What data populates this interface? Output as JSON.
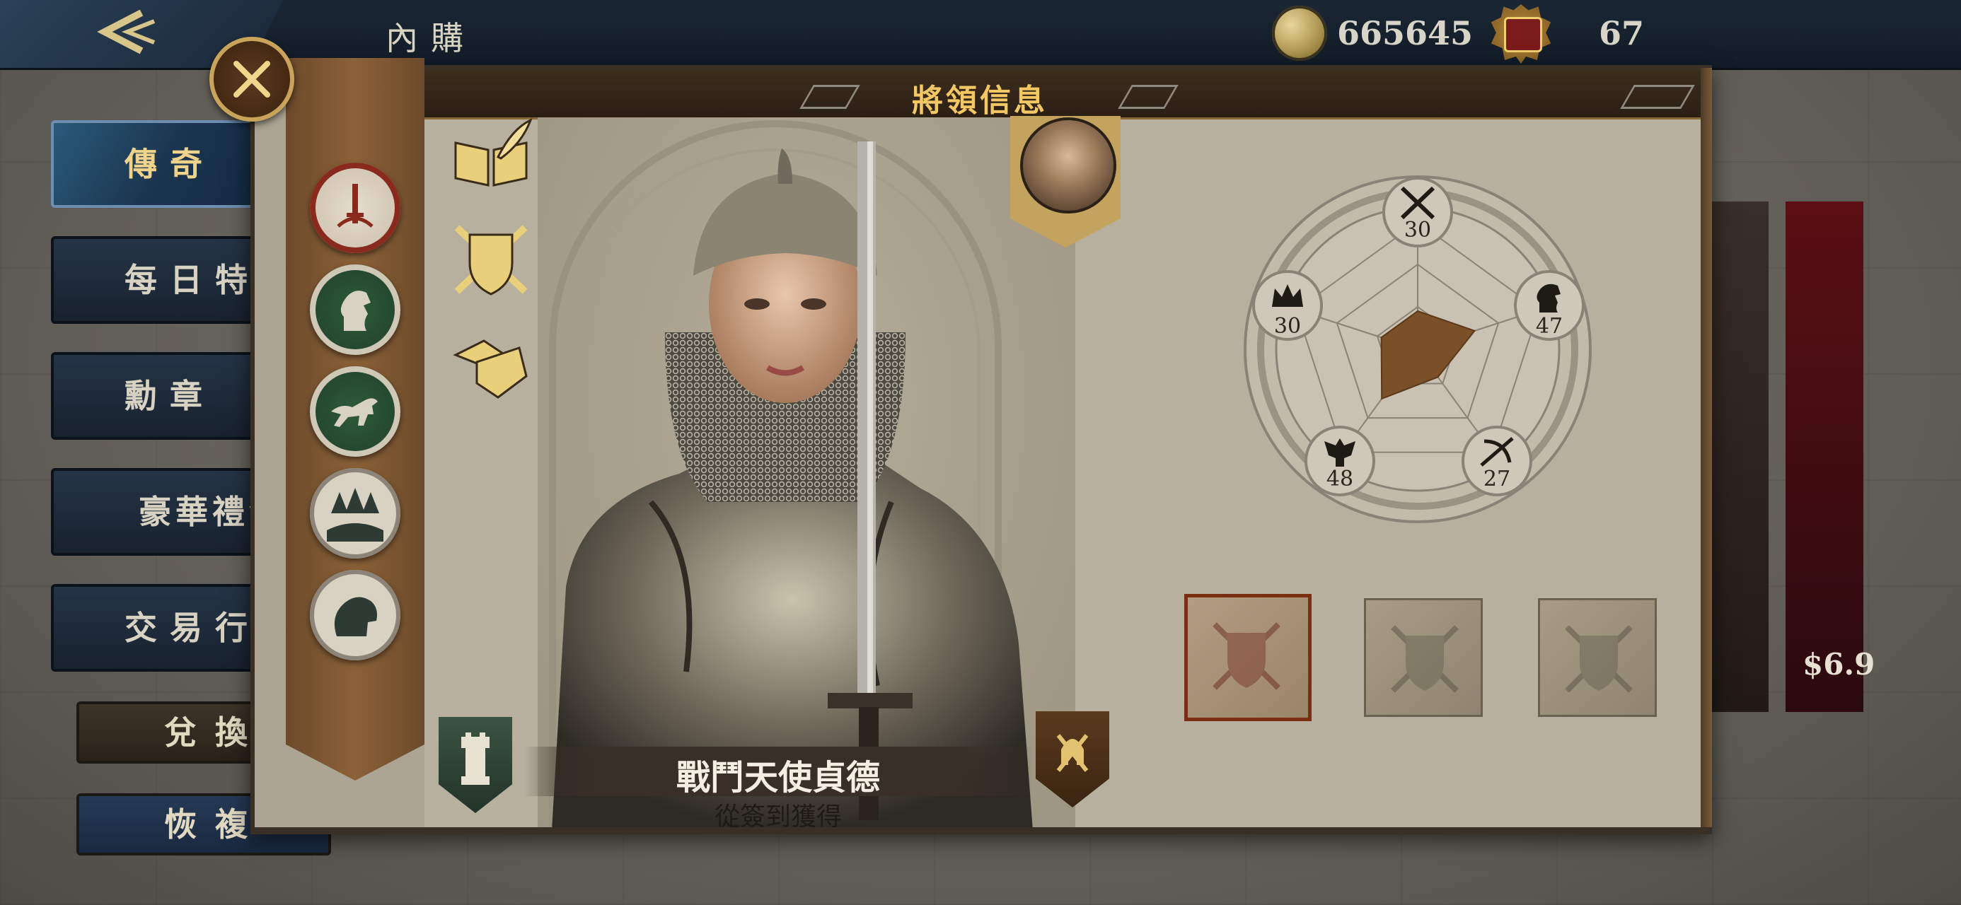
{
  "topbar": {
    "title": "內購",
    "coins": "665645",
    "gems": "67"
  },
  "menu": {
    "items": [
      {
        "label": "傳奇",
        "active": true
      },
      {
        "label": "每日特"
      },
      {
        "label": "勳章"
      },
      {
        "label": "豪華禮包"
      },
      {
        "label": "交易行"
      }
    ],
    "exchange_label": "兌換",
    "restore_label": "恢複"
  },
  "background_card": {
    "price": "$6.9"
  },
  "panel": {
    "title": "將領信息",
    "hero_name": "戰鬥天使貞德",
    "hero_source": "從簽到獲得"
  },
  "stats": {
    "sword": "30",
    "horse": "47",
    "bow": "27",
    "eagle": "48",
    "crown": "30"
  },
  "radar_values": {
    "sword": 30,
    "horse": 47,
    "bow": 27,
    "eagle": 48,
    "crown": 30,
    "max": 100
  },
  "icons": {
    "close": "close-icon",
    "back": "back-arrow-icon",
    "coin": "coin-icon",
    "crown_badge": "crown-badge-icon",
    "book": "book-quill-icon",
    "shield_swords": "shield-swords-icon",
    "handshake": "handshake-icon",
    "sword_emblem": "sword-emblem-icon",
    "knight_laurel": "knight-laurel-icon",
    "horse_run": "horse-run-icon",
    "forest": "forest-icon",
    "horse_head": "horse-head-icon",
    "chess_rook": "chess-rook-icon",
    "spartan_helmet": "spartan-helmet-icon"
  },
  "colors": {
    "title_gold": "#f2c764",
    "radar_fill": "#7a5028",
    "selected_slot_border": "#7a2e12"
  }
}
